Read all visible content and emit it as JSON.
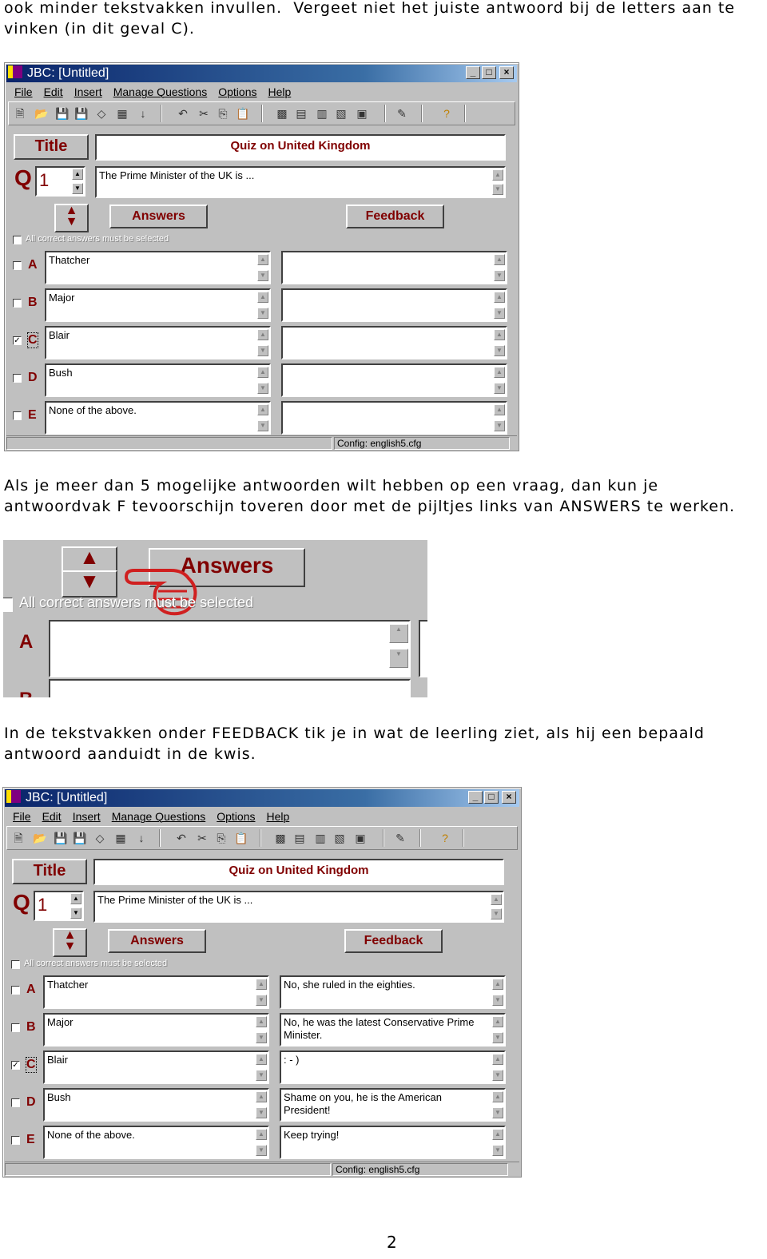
{
  "paragraphs": [
    "ook minder tekstvakken invullen.  Vergeet niet het juiste antwoord bij de letters aan te vinken (in dit geval C).",
    "Als je meer dan 5 mogelijke antwoorden wilt hebben op een vraag, dan kun je antwoordvak F tevoorschijn toveren door met de pijltjes links van ANSWERS te werken.",
    "In de tekstvakken onder FEEDBACK tik je in wat de leerling ziet, als hij een bepaald antwoord aanduidt in de kwis."
  ],
  "page_number": "2",
  "accent_color": "#800000",
  "windows": [
    {
      "title": "JBC: [Untitled]",
      "menu": [
        "File",
        "Edit",
        "Insert",
        "Manage Questions",
        "Options",
        "Help"
      ],
      "title_button": "Title",
      "quiz_title": "Quiz on United Kingdom",
      "q_label": "Q",
      "q_number": "1",
      "question": "The Prime Minister of the UK is ...",
      "answers_button": "Answers",
      "feedback_button": "Feedback",
      "all_correct_label": "All correct answers must be selected",
      "rows": [
        {
          "letter": "A",
          "answer": "Thatcher",
          "feedback": "",
          "checked": false
        },
        {
          "letter": "B",
          "answer": "Major",
          "feedback": "",
          "checked": false
        },
        {
          "letter": "C",
          "answer": "Blair",
          "feedback": "",
          "checked": true
        },
        {
          "letter": "D",
          "answer": "Bush",
          "feedback": "",
          "checked": false
        },
        {
          "letter": "E",
          "answer": "None of the above.",
          "feedback": "",
          "checked": false
        }
      ],
      "status": "Config: english5.cfg"
    },
    {
      "title": "JBC: [Untitled]",
      "menu": [
        "File",
        "Edit",
        "Insert",
        "Manage Questions",
        "Options",
        "Help"
      ],
      "title_button": "Title",
      "quiz_title": "Quiz on United Kingdom",
      "q_label": "Q",
      "q_number": "1",
      "question": "The Prime Minister of the UK is ...",
      "answers_button": "Answers",
      "feedback_button": "Feedback",
      "all_correct_label": "All correct answers must be selected",
      "rows": [
        {
          "letter": "A",
          "answer": "Thatcher",
          "feedback": "No, she ruled in the eighties.",
          "checked": false
        },
        {
          "letter": "B",
          "answer": "Major",
          "feedback": "No, he was the latest Conservative Prime Minister.",
          "checked": false
        },
        {
          "letter": "C",
          "answer": "Blair",
          "feedback": ": - )",
          "checked": true
        },
        {
          "letter": "D",
          "answer": "Bush",
          "feedback": "Shame on you, he is the American President!",
          "checked": false
        },
        {
          "letter": "E",
          "answer": "None of the above.",
          "feedback": "Keep trying!",
          "checked": false
        }
      ],
      "status": "Config: english5.cfg"
    }
  ],
  "zoom_crop": {
    "answers_button": "Answers",
    "all_correct_label": "All correct answers must be selected",
    "letter_a": "A",
    "letter_b": "B"
  }
}
